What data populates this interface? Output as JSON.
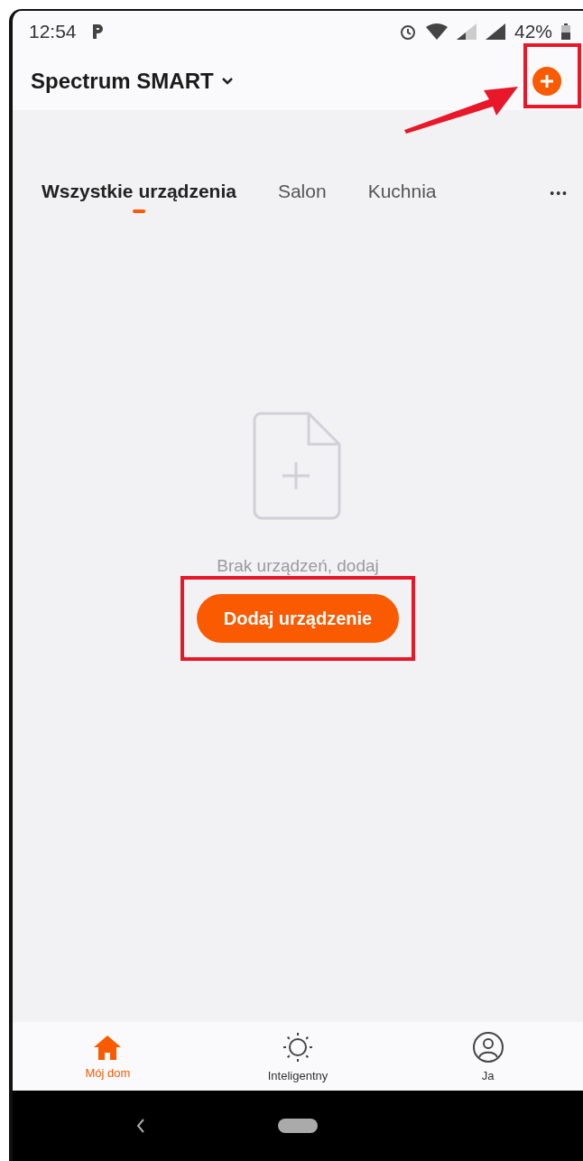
{
  "status_bar": {
    "time": "12:54",
    "battery": "42%"
  },
  "header": {
    "title": "Spectrum SMART",
    "add_button": {
      "highlighted": true,
      "pointer_arrow": true
    }
  },
  "tabs": [
    {
      "label": "Wszystkie urządzenia",
      "selected": true
    },
    {
      "label": "Salon",
      "selected": false
    },
    {
      "label": "Kuchnia",
      "selected": false
    }
  ],
  "more": "•••",
  "empty_state": {
    "message": "Brak urządzeń, dodaj",
    "button": {
      "label": "Dodaj urządzenie",
      "highlighted": true
    }
  },
  "bottom_nav": [
    {
      "label": "Mój dom",
      "kind": "home",
      "selected": true
    },
    {
      "label": "Inteligentny",
      "kind": "smart",
      "selected": false
    },
    {
      "label": "Ja",
      "kind": "profile",
      "selected": false
    }
  ]
}
